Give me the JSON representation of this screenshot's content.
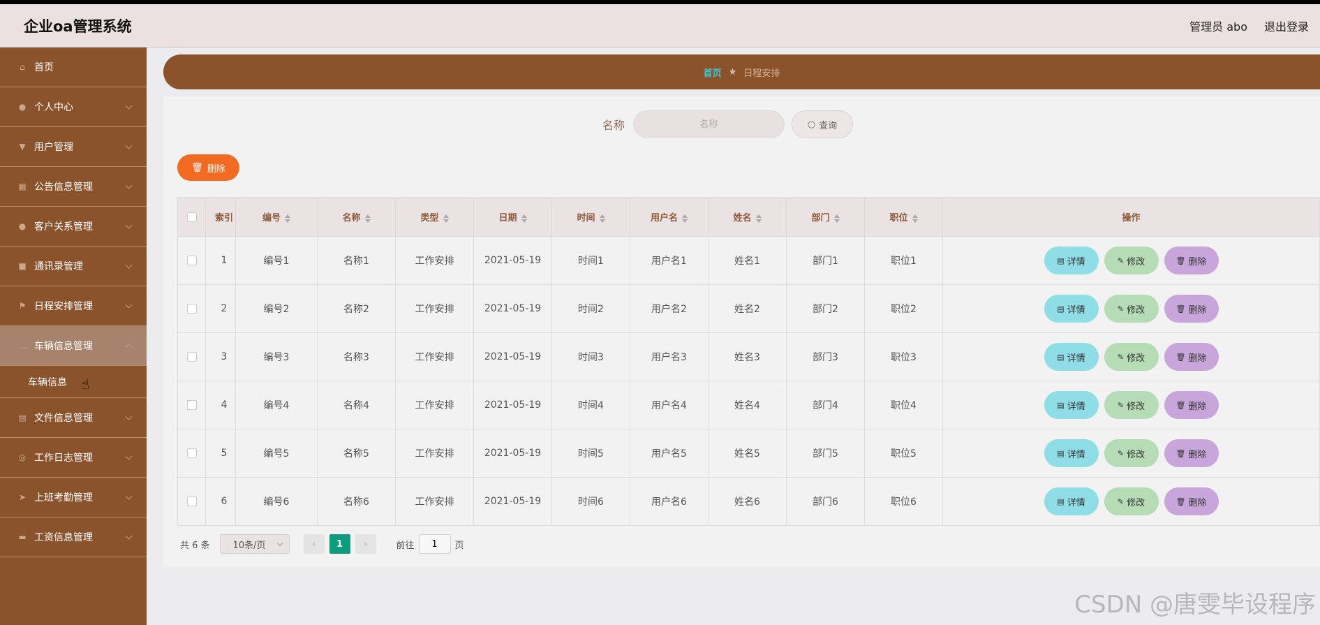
{
  "header": {
    "title": "企业oa管理系统",
    "user": "管理员 abo",
    "logout": "退出登录"
  },
  "sidebar": {
    "items": [
      {
        "label": "首页",
        "icon": "home-icon"
      },
      {
        "label": "个人中心",
        "icon": "user-icon"
      },
      {
        "label": "用户管理",
        "icon": "users-icon"
      },
      {
        "label": "公告信息管理",
        "icon": "grid-icon"
      },
      {
        "label": "客户关系管理",
        "icon": "contact-icon"
      },
      {
        "label": "通讯录管理",
        "icon": "briefcase-icon"
      },
      {
        "label": "日程安排管理",
        "icon": "flag-icon"
      },
      {
        "label": "车辆信息管理",
        "icon": "chat-icon"
      },
      {
        "label": "文件信息管理",
        "icon": "clipboard-icon"
      },
      {
        "label": "工作日志管理",
        "icon": "compass-icon"
      },
      {
        "label": "上班考勤管理",
        "icon": "send-icon"
      },
      {
        "label": "工资信息管理",
        "icon": "card-icon"
      }
    ],
    "submenu": "车辆信息"
  },
  "breadcrumb": {
    "home": "首页",
    "current": "日程安排"
  },
  "search": {
    "label": "名称",
    "placeholder": "名称",
    "button": "查询"
  },
  "toolbar": {
    "delete": "删除"
  },
  "table": {
    "headers": [
      "索引",
      "编号",
      "名称",
      "类型",
      "日期",
      "时间",
      "用户名",
      "姓名",
      "部门",
      "职位",
      "操作"
    ],
    "rows": [
      [
        "1",
        "编号1",
        "名称1",
        "工作安排",
        "2021-05-19",
        "时间1",
        "用户名1",
        "姓名1",
        "部门1",
        "职位1"
      ],
      [
        "2",
        "编号2",
        "名称2",
        "工作安排",
        "2021-05-19",
        "时间2",
        "用户名2",
        "姓名2",
        "部门2",
        "职位2"
      ],
      [
        "3",
        "编号3",
        "名称3",
        "工作安排",
        "2021-05-19",
        "时间3",
        "用户名3",
        "姓名3",
        "部门3",
        "职位3"
      ],
      [
        "4",
        "编号4",
        "名称4",
        "工作安排",
        "2021-05-19",
        "时间4",
        "用户名4",
        "姓名4",
        "部门4",
        "职位4"
      ],
      [
        "5",
        "编号5",
        "名称5",
        "工作安排",
        "2021-05-19",
        "时间5",
        "用户名5",
        "姓名5",
        "部门5",
        "职位5"
      ],
      [
        "6",
        "编号6",
        "名称6",
        "工作安排",
        "2021-05-19",
        "时间6",
        "用户名6",
        "姓名6",
        "部门6",
        "职位6"
      ]
    ],
    "actions": {
      "detail": "详情",
      "edit": "修改",
      "delete": "删除"
    }
  },
  "pagination": {
    "total": "共 6 条",
    "page_size": "10条/页",
    "current": "1",
    "goto_label": "前往",
    "goto_value": "1",
    "page_suffix": "页"
  },
  "watermark": "CSDN @唐雯毕设程序",
  "colors": {
    "sidebar": "#8b532c",
    "accent": "#f36b23",
    "detail": "#8fdde6",
    "edit": "#b5dcb4",
    "delete": "#c8a6dc",
    "current_page": "#0f9b7e"
  }
}
